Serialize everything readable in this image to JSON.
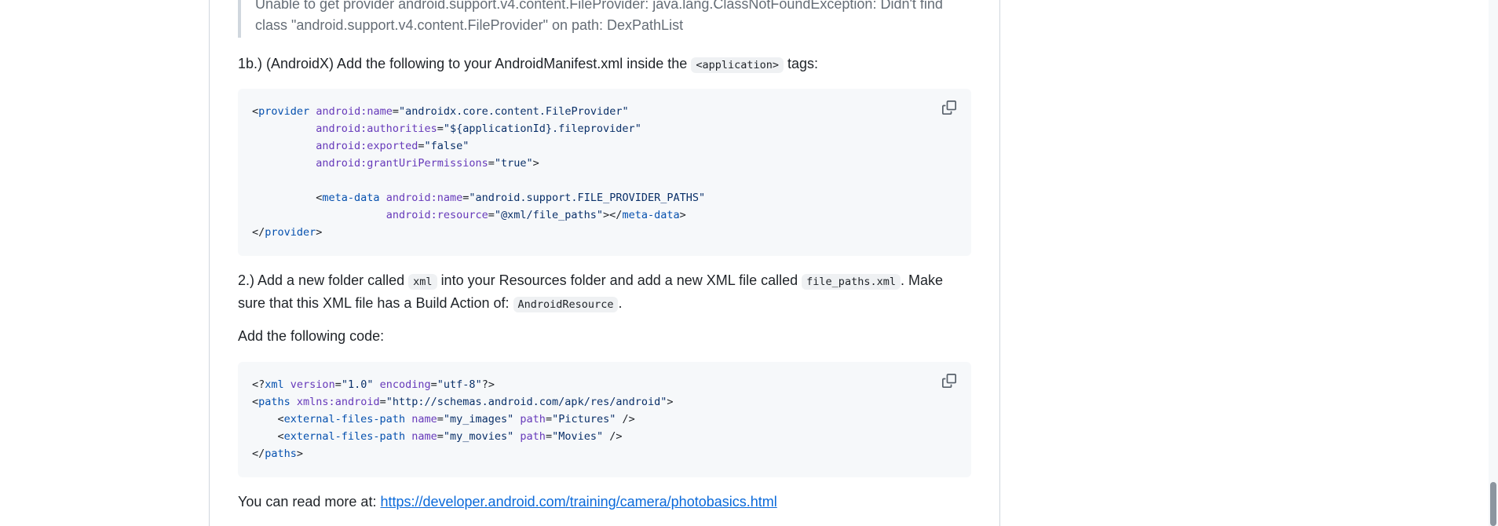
{
  "quote": {
    "line1": "Unable to get provider android.support.v4.content.FileProvider: java.lang.ClassNotFoundException: Didn't find",
    "line2": "class \"android.support.v4.content.FileProvider\" on path: DexPathList"
  },
  "step1b": {
    "prefix": "1b.) (AndroidX) Add the following to your AndroidManifest.xml inside the",
    "code": "<application>",
    "suffix": "tags:"
  },
  "codeblock1": {
    "lines": [
      "<provider android:name=\"androidx.core.content.FileProvider\"",
      "          android:authorities=\"${applicationId}.fileprovider\"",
      "          android:exported=\"false\"",
      "          android:grantUriPermissions=\"true\">",
      "",
      "          <meta-data android:name=\"android.support.FILE_PROVIDER_PATHS\"",
      "                     android:resource=\"@xml/file_paths\"></meta-data>",
      "</provider>"
    ]
  },
  "step2": {
    "part1": "2.) Add a new folder called",
    "code1": "xml",
    "part2": "into your Resources folder and add a new XML file called",
    "code2": "file_paths.xml",
    "part3": ". Make",
    "part4": "sure that this XML file has a Build Action of:",
    "code3": "AndroidResource",
    "part5": "."
  },
  "add_code_label": "Add the following code:",
  "codeblock2": {
    "lines": [
      "<?xml version=\"1.0\" encoding=\"utf-8\"?>",
      "<paths xmlns:android=\"http://schemas.android.com/apk/res/android\">",
      "    <external-files-path name=\"my_images\" path=\"Pictures\" />",
      "    <external-files-path name=\"my_movies\" path=\"Movies\" />",
      "</paths>"
    ]
  },
  "read_more": {
    "prefix": "You can read more at:",
    "link": "https://developer.android.com/training/camera/photobasics.html"
  },
  "icons": {
    "copy": "copy-icon"
  }
}
